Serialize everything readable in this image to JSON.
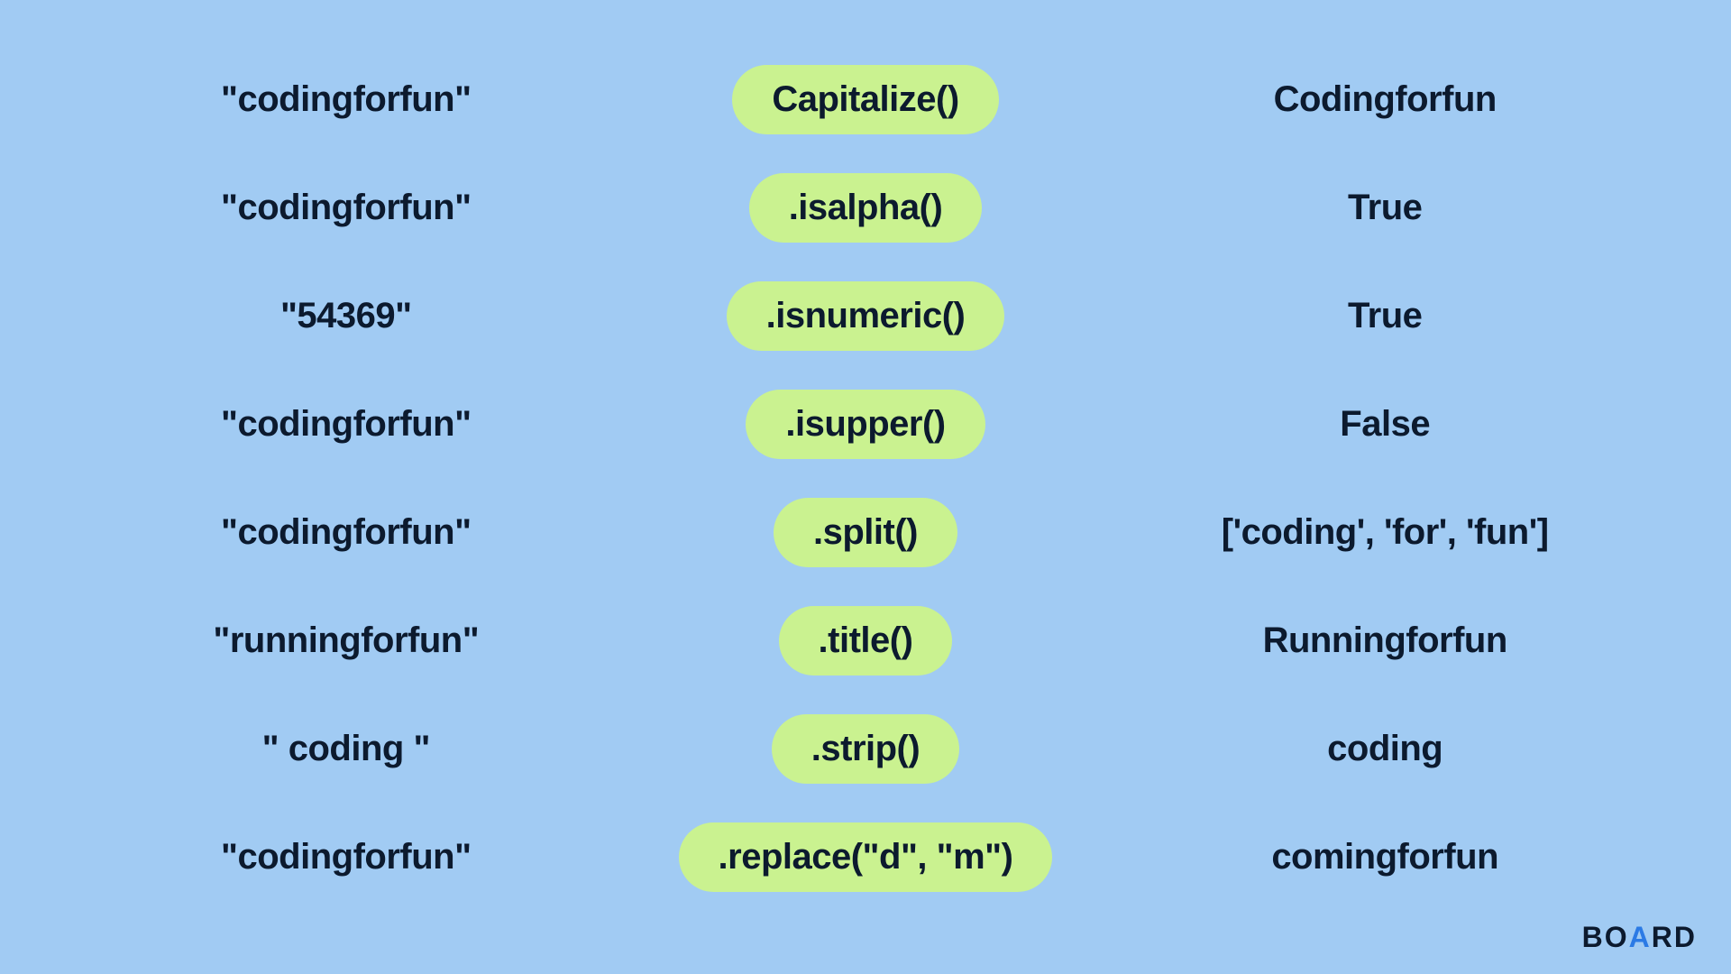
{
  "rows": [
    {
      "input": "\"codingforfun\"",
      "method": "Capitalize()",
      "output": "Codingforfun"
    },
    {
      "input": "\"codingforfun\"",
      "method": ".isalpha()",
      "output": "True"
    },
    {
      "input": "\"54369\"",
      "method": ".isnumeric()",
      "output": "True"
    },
    {
      "input": "\"codingforfun\"",
      "method": ".isupper()",
      "output": "False"
    },
    {
      "input": "\"codingforfun\"",
      "method": ".split()",
      "output": "['coding', 'for', 'fun']"
    },
    {
      "input": "\"runningforfun\"",
      "method": ".title()",
      "output": "Runningforfun"
    },
    {
      "input": "\" coding \"",
      "method": ".strip()",
      "output": "coding"
    },
    {
      "input": "\"codingforfun\"",
      "method": ".replace(\"d\", \"m\")",
      "output": "comingforfun"
    }
  ],
  "logo": {
    "b": "B",
    "o1": "O",
    "a": "A",
    "r": "R",
    "d": "D"
  }
}
